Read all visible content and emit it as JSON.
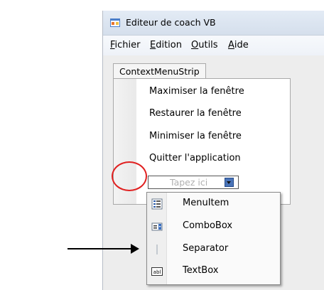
{
  "window": {
    "title": "Editeur de coach VB",
    "app_icon": "vb-form-icon"
  },
  "menubar": {
    "items": [
      {
        "label_u": "F",
        "label_rest": "ichier"
      },
      {
        "label_u": "E",
        "label_rest": "dition"
      },
      {
        "label_u": "O",
        "label_rest": "utils"
      },
      {
        "label_u": "A",
        "label_rest": "ide"
      }
    ]
  },
  "context_menu_strip": {
    "tab_label": "ContextMenuStrip",
    "items": [
      "Maximiser la fenêtre",
      "Restaurer la fenêtre",
      "Minimiser la fenêtre",
      "Quitter l'application"
    ],
    "type_here_placeholder": "Tapez ici"
  },
  "dropdown": {
    "items": [
      {
        "label": "MenuItem",
        "icon": "menuitem-icon"
      },
      {
        "label": "ComboBox",
        "icon": "combobox-icon"
      },
      {
        "label": "Separator",
        "icon": "separator-icon"
      },
      {
        "label": "TextBox",
        "icon": "textbox-icon",
        "icon_text": "abl"
      }
    ]
  },
  "annotations": {
    "highlight_color": "#e02020",
    "arrow_color": "#000000"
  }
}
